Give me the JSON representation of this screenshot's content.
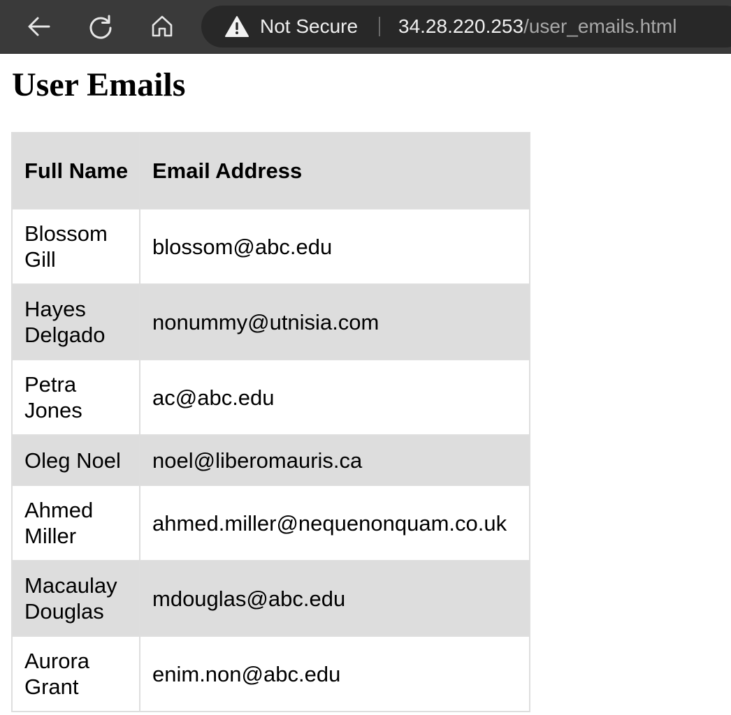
{
  "browser": {
    "security_label": "Not Secure",
    "url_host": "34.28.220.253",
    "url_path": "/user_emails.html",
    "icons": {
      "back": "arrow-left-icon",
      "reload": "reload-icon",
      "home": "home-icon",
      "security": "warning-triangle-icon"
    }
  },
  "page": {
    "title": "User Emails"
  },
  "table": {
    "columns": [
      "Full Name",
      "Email Address"
    ],
    "rows": [
      {
        "name": "Blossom Gill",
        "email": "blossom@abc.edu"
      },
      {
        "name": "Hayes Delgado",
        "email": "nonummy@utnisia.com"
      },
      {
        "name": "Petra Jones",
        "email": "ac@abc.edu"
      },
      {
        "name": "Oleg Noel",
        "email": "noel@liberomauris.ca"
      },
      {
        "name": "Ahmed Miller",
        "email": "ahmed.miller@nequenonquam.co.uk"
      },
      {
        "name": "Macaulay Douglas",
        "email": "mdouglas@abc.edu"
      },
      {
        "name": "Aurora Grant",
        "email": "enim.non@abc.edu"
      }
    ]
  },
  "colors": {
    "toolbar": "#3a3a3a",
    "address_bar": "#282828",
    "row_stripe": "#dddddd"
  }
}
